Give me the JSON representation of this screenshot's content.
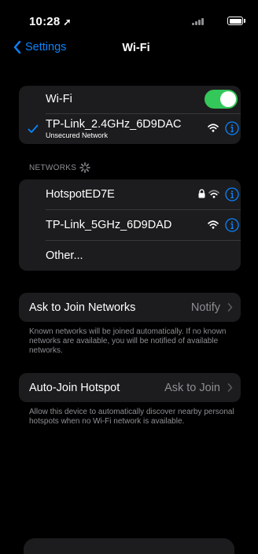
{
  "status_bar": {
    "time": "10:28",
    "location_glyph": "➚"
  },
  "nav": {
    "back_label": "Settings",
    "title": "Wi-Fi"
  },
  "wifi_group": {
    "toggle_label": "Wi-Fi",
    "toggle_on": true,
    "connected_network": {
      "name": "TP-Link_2.4GHz_6D9DAC",
      "subtitle": "Unsecured Network"
    }
  },
  "networks": {
    "header": "NETWORKS",
    "items": [
      {
        "name": "HotspotED7E",
        "locked": true
      },
      {
        "name": "TP-Link_5GHz_6D9DAD",
        "locked": false
      }
    ],
    "other_label": "Other..."
  },
  "ask_to_join": {
    "label": "Ask to Join Networks",
    "value": "Notify",
    "footer": "Known networks will be joined automatically. If no known networks are available, you will be notified of available networks."
  },
  "auto_join_hotspot": {
    "label": "Auto-Join Hotspot",
    "value": "Ask to Join",
    "footer": "Allow this device to automatically discover nearby personal hotspots when no Wi-Fi network is available."
  },
  "colors": {
    "accent": "#0a84ff",
    "toggle_on": "#34c759",
    "cell_bg": "#1c1c1e",
    "secondary_text": "#8e8e93"
  },
  "icons": [
    "location-arrow-icon",
    "signal-icon",
    "battery-icon",
    "chevron-left-icon",
    "checkmark-icon",
    "wifi-icon",
    "info-icon",
    "lock-icon",
    "spinner-icon",
    "chevron-right-icon"
  ]
}
